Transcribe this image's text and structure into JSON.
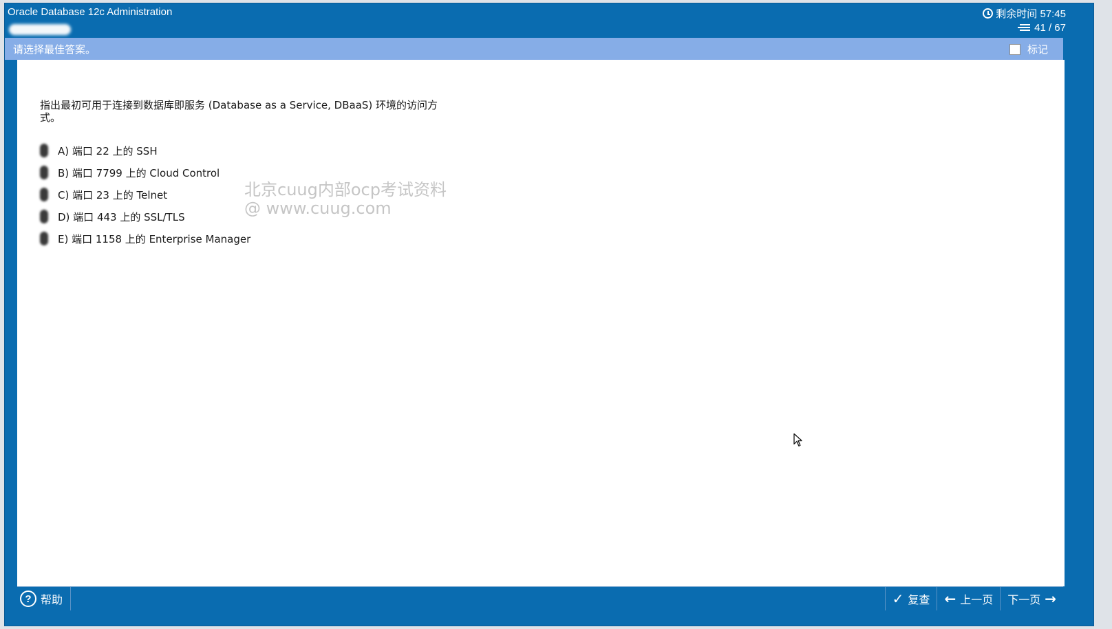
{
  "app": {
    "title": "Oracle Database 12c Administration",
    "timer_label": "剩余时间 57:45",
    "progress_label": "41 / 67"
  },
  "instruction": {
    "text": "请选择最佳答案。",
    "mark_label": "标记"
  },
  "question": {
    "text": "指出最初可用于连接到数据库即服务 (Database as a Service, DBaaS) 环境的访问方式。",
    "options": [
      "A) 端口 22 上的 SSH",
      "B) 端口 7799 上的 Cloud Control",
      "C) 端口 23 上的 Telnet",
      "D) 端口 443 上的 SSL/TLS",
      "E) 端口 1158 上的 Enterprise Manager"
    ]
  },
  "watermark": {
    "line1": "北京cuug内部ocp考试资料",
    "line2": "@ www.cuug.com"
  },
  "footer": {
    "help_label": "帮助",
    "review_label": "复查",
    "prev_label": "上一页",
    "next_label": "下一页"
  },
  "icons": {
    "clock": "clock-icon",
    "list": "list-icon",
    "help": "help-icon",
    "check": "check-icon",
    "prev": "arrow-left-icon",
    "next": "arrow-right-icon",
    "cursor": "mouse-cursor-icon"
  },
  "colors": {
    "primary": "#0a6cb0",
    "instruction_bar": "#86ade7",
    "content_bg": "#ffffff"
  }
}
